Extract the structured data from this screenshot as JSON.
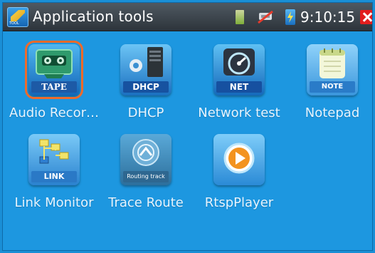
{
  "titlebar": {
    "title": "Application tools",
    "logo_text": "TOOL",
    "time": "9:10:15",
    "icons": [
      "tool-logo-icon",
      "sd-card-icon",
      "network-disconnected-icon",
      "battery-charging-icon",
      "close-icon"
    ],
    "close_color": "#e21e1e"
  },
  "apps": [
    {
      "id": "tape",
      "label": "Audio Recor…",
      "badge": "TAPE",
      "icon": "tape-recorder-icon",
      "selected": true
    },
    {
      "id": "dhcp",
      "label": "DHCP",
      "badge": "DHCP",
      "icon": "server-gear-icon",
      "selected": false
    },
    {
      "id": "net",
      "label": "Network test",
      "badge": "NET",
      "icon": "speedometer-icon",
      "selected": false
    },
    {
      "id": "note",
      "label": "Notepad",
      "badge": "NOTE",
      "icon": "notepad-icon",
      "selected": false
    },
    {
      "id": "link",
      "label": "Link Monitor",
      "badge": "LINK",
      "icon": "link-tree-icon",
      "selected": false
    },
    {
      "id": "trace",
      "label": "Trace Route",
      "badge": "Routing track",
      "icon": "routing-track-icon",
      "selected": false
    },
    {
      "id": "rtsp",
      "label": "RtspPlayer",
      "badge": "",
      "icon": "play-icon",
      "selected": false
    }
  ],
  "colors": {
    "background": "#1d97e0",
    "titlebar": "#3a424a",
    "selection_outline": "#f06a2a"
  }
}
